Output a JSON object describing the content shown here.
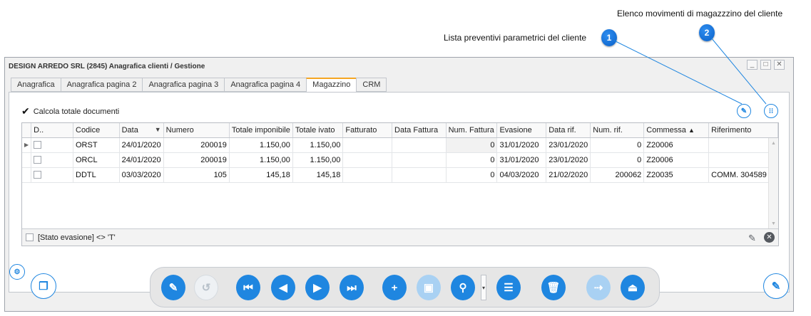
{
  "callouts": [
    {
      "number": "1",
      "text": "Lista preventivi parametrici del cliente"
    },
    {
      "number": "2",
      "text": "Elenco movimenti di  magazzzino del cliente"
    }
  ],
  "window": {
    "title": "DESIGN ARREDO SRL (2845) Anagrafica clienti / Gestione",
    "controls": {
      "minimize": "_",
      "maximize": "□",
      "close": "✕"
    }
  },
  "tabs": [
    {
      "label": "Anagrafica"
    },
    {
      "label": "Anagrafica pagina 2"
    },
    {
      "label": "Anagrafica pagina 3"
    },
    {
      "label": "Anagrafica pagina 4"
    },
    {
      "label": "Magazzino",
      "active": true
    },
    {
      "label": "CRM"
    }
  ],
  "options": {
    "calcola_totale_label": "Calcola totale documenti",
    "calcola_totale_checked": true
  },
  "grid": {
    "columns": [
      "D..",
      "Codice",
      "Data",
      "Numero",
      "Totale imponibile",
      "Totale ivato",
      "Fatturato",
      "Data Fattura",
      "Num. Fattura",
      "Evasione",
      "Data rif.",
      "Num. rif.",
      "Commessa",
      "Riferimento"
    ],
    "sorted_desc": "Data",
    "sorted_asc": "Commessa",
    "rows": [
      {
        "codice": "ORST",
        "data": "24/01/2020",
        "numero": "200019",
        "imponibile": "1.150,00",
        "ivato": "1.150,00",
        "fatturato": "",
        "data_fattura": "",
        "num_fattura": "0",
        "evasione": "31/01/2020",
        "data_rif": "23/01/2020",
        "num_rif": "0",
        "commessa": "Z20006",
        "riferimento": ""
      },
      {
        "codice": "ORCL",
        "data": "24/01/2020",
        "numero": "200019",
        "imponibile": "1.150,00",
        "ivato": "1.150,00",
        "fatturato": "",
        "data_fattura": "",
        "num_fattura": "0",
        "evasione": "31/01/2020",
        "data_rif": "23/01/2020",
        "num_rif": "0",
        "commessa": "Z20006",
        "riferimento": ""
      },
      {
        "codice": "DDTL",
        "data": "03/03/2020",
        "numero": "105",
        "imponibile": "145,18",
        "ivato": "145,18",
        "fatturato": "",
        "data_fattura": "",
        "num_fattura": "0",
        "evasione": "04/03/2020",
        "data_rif": "21/02/2020",
        "num_rif": "200062",
        "commessa": "Z20035",
        "riferimento": "COMM. 304589"
      }
    ],
    "filter_text": "[Stato evasione] <> 'T'"
  },
  "colors": {
    "accent": "#1f86e0",
    "tab_active_border": "#f5a623",
    "callout_badge": "#0a6fd8"
  }
}
